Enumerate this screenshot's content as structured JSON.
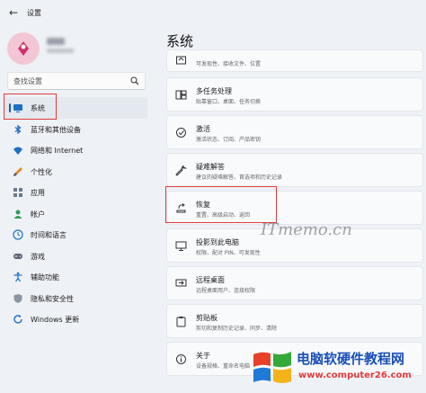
{
  "window": {
    "title": "设置"
  },
  "search": {
    "placeholder": "查找设置"
  },
  "sidebar": {
    "items": [
      {
        "label": "系统",
        "icon": "monitor-icon"
      },
      {
        "label": "蓝牙和其他设备",
        "icon": "bluetooth-icon"
      },
      {
        "label": "网络和 Internet",
        "icon": "wifi-icon"
      },
      {
        "label": "个性化",
        "icon": "brush-icon"
      },
      {
        "label": "应用",
        "icon": "apps-icon"
      },
      {
        "label": "帐户",
        "icon": "person-icon"
      },
      {
        "label": "时间和语言",
        "icon": "globe-clock-icon"
      },
      {
        "label": "游戏",
        "icon": "gamepad-icon"
      },
      {
        "label": "辅助功能",
        "icon": "accessibility-icon"
      },
      {
        "label": "隐私和安全性",
        "icon": "shield-icon"
      },
      {
        "label": "Windows 更新",
        "icon": "update-icon"
      }
    ]
  },
  "main": {
    "title": "系统",
    "cards": [
      {
        "title": "",
        "subtitle": "可发现性、接收文件、位置",
        "icon": "share-icon"
      },
      {
        "title": "多任务处理",
        "subtitle": "贴靠窗口、桌面、任务切换",
        "icon": "multitask-icon"
      },
      {
        "title": "激活",
        "subtitle": "激活状态、订阅、产品密钥",
        "icon": "check-circle-icon"
      },
      {
        "title": "疑难解答",
        "subtitle": "建议的疑难解答、首选项和历史记录",
        "icon": "wrench-icon"
      },
      {
        "title": "恢复",
        "subtitle": "重置、高级启动、返回",
        "icon": "recovery-icon"
      },
      {
        "title": "投影到此电脑",
        "subtitle": "权限、配对 PIN、可发现性",
        "icon": "project-icon"
      },
      {
        "title": "远程桌面",
        "subtitle": "远程桌面用户、连接权限",
        "icon": "remote-desktop-icon"
      },
      {
        "title": "剪贴板",
        "subtitle": "剪切和复制历史记录、同步、清除",
        "icon": "clipboard-icon"
      },
      {
        "title": "关于",
        "subtitle": "设备规格、重命名电脑",
        "icon": "info-icon"
      }
    ]
  },
  "watermark": {
    "text": "ITmemo.cn"
  },
  "brand": {
    "name": "电脑软硬件教程网",
    "url": "www.computer26.com"
  },
  "colors": {
    "accent": "#0067c0",
    "highlight": "#e23b3b",
    "brand_blue": "#1a4fb8"
  }
}
